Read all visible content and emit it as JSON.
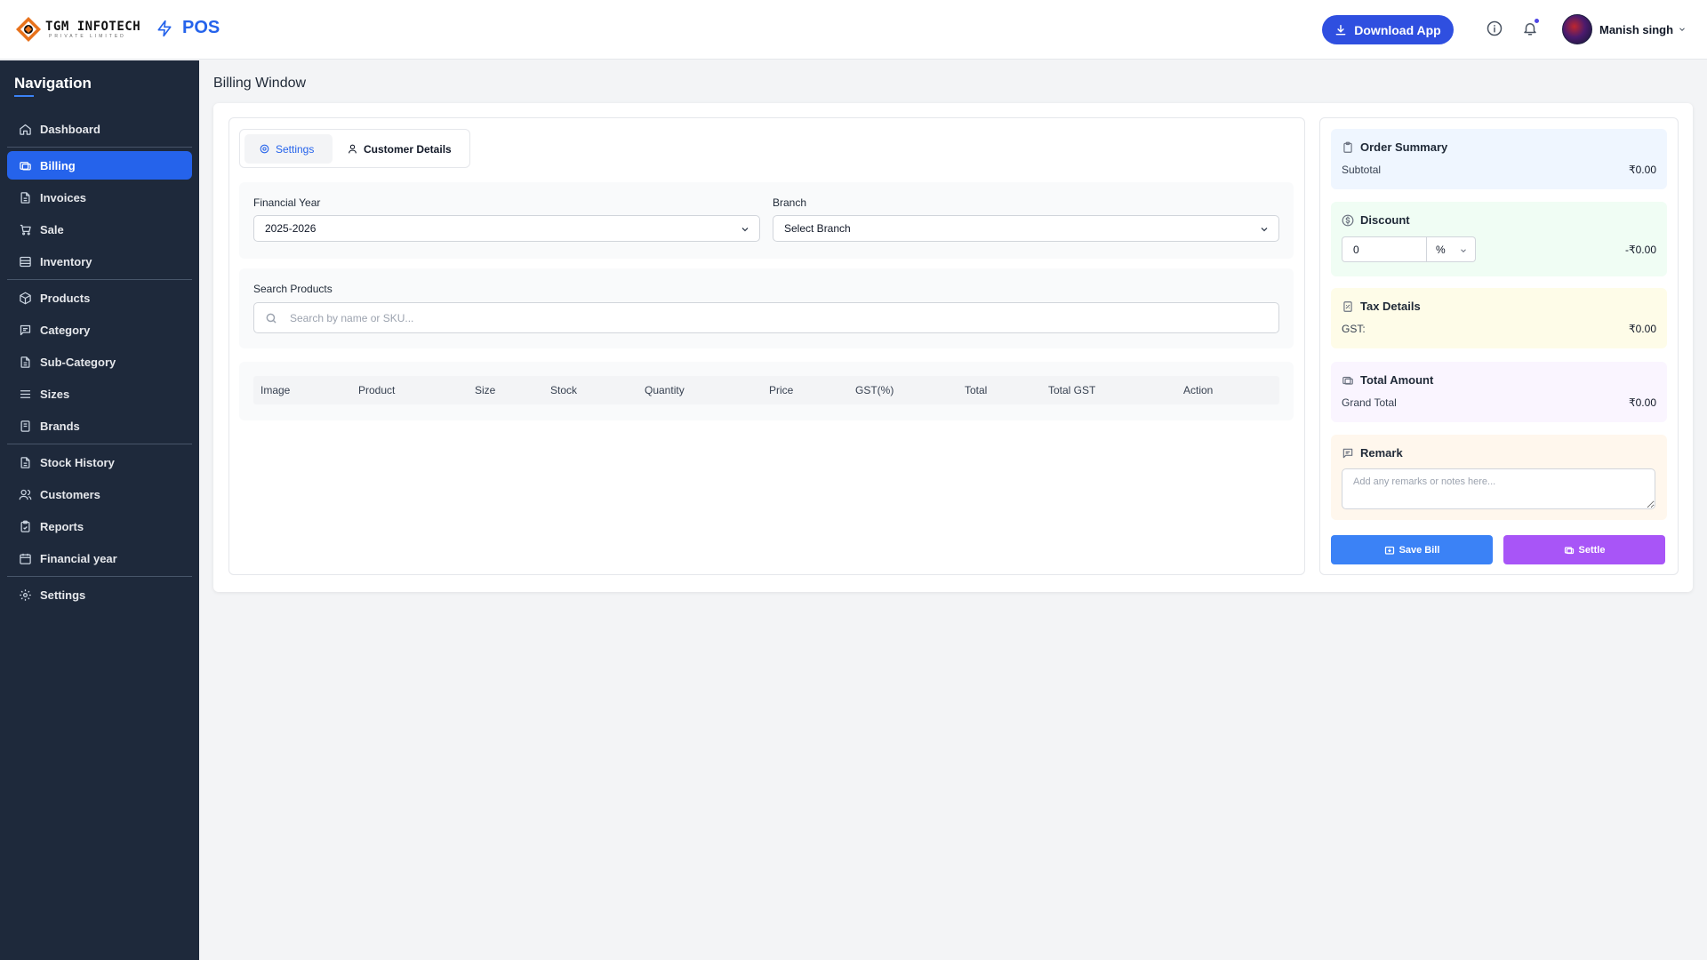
{
  "header": {
    "logo_text": "TGM INFOTECH",
    "logo_subtext": "PRIVATE LIMITED",
    "app_name": "POS",
    "download_label": "Download App",
    "user_name": "Manish singh"
  },
  "sidebar": {
    "title": "Navigation",
    "items": [
      {
        "label": "Dashboard",
        "icon": "home-icon"
      },
      {
        "label": "Billing",
        "icon": "billing-icon",
        "active": true
      },
      {
        "label": "Invoices",
        "icon": "file-icon"
      },
      {
        "label": "Sale",
        "icon": "cart-icon"
      },
      {
        "label": "Inventory",
        "icon": "inventory-icon"
      },
      {
        "label": "Products",
        "icon": "box-icon"
      },
      {
        "label": "Category",
        "icon": "category-icon"
      },
      {
        "label": "Sub-Category",
        "icon": "file-icon"
      },
      {
        "label": "Sizes",
        "icon": "list-icon"
      },
      {
        "label": "Brands",
        "icon": "brand-icon"
      },
      {
        "label": "Stock History",
        "icon": "file-icon"
      },
      {
        "label": "Customers",
        "icon": "users-icon"
      },
      {
        "label": "Reports",
        "icon": "clipboard-icon"
      },
      {
        "label": "Financial year",
        "icon": "calendar-icon"
      },
      {
        "label": "Settings",
        "icon": "gear-icon"
      }
    ]
  },
  "main": {
    "page_title": "Billing Window",
    "tabs": [
      {
        "label": "Settings",
        "active": true
      },
      {
        "label": "Customer Details",
        "active": false
      }
    ],
    "financial_year": {
      "label": "Financial Year",
      "value": "2025-2026"
    },
    "branch": {
      "label": "Branch",
      "value": "Select Branch"
    },
    "search": {
      "label": "Search Products",
      "placeholder": "Search by name or SKU..."
    },
    "table_columns": [
      "Image",
      "Product",
      "Size",
      "Stock",
      "Quantity",
      "Price",
      "GST(%)",
      "Total",
      "Total GST",
      "Action"
    ]
  },
  "summary": {
    "order": {
      "title": "Order Summary",
      "label": "Subtotal",
      "value": "₹0.00"
    },
    "discount": {
      "title": "Discount",
      "input_value": "0",
      "unit": "%",
      "value": "-₹0.00"
    },
    "tax": {
      "title": "Tax Details",
      "label": "GST:",
      "value": "₹0.00"
    },
    "total": {
      "title": "Total Amount",
      "label": "Grand Total",
      "value": "₹0.00"
    },
    "remark": {
      "title": "Remark",
      "placeholder": "Add any remarks or notes here..."
    },
    "save_label": "Save Bill",
    "settle_label": "Settle"
  },
  "colors": {
    "primary": "#2563eb",
    "sidebar_bg": "#1e293b",
    "settle": "#a855f7",
    "save": "#3b82f6",
    "order_bg": "#eff6ff",
    "discount_bg": "#f0fdf4",
    "tax_bg": "#fefce8",
    "total_bg": "#faf5ff",
    "remark_bg": "#fff7ed"
  }
}
